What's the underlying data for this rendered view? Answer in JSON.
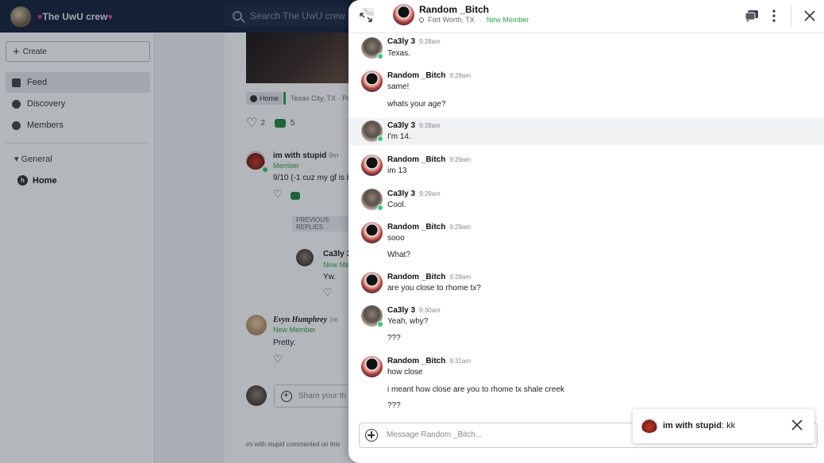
{
  "app": {
    "group_name": "The UwU crew",
    "search_placeholder": "Search The UwU crew"
  },
  "sidebar": {
    "create_label": "Create",
    "items": [
      {
        "label": "Feed",
        "icon": "feed-icon",
        "active": true
      },
      {
        "label": "Discovery",
        "icon": "compass-icon",
        "active": false
      },
      {
        "label": "Members",
        "icon": "members-icon",
        "active": false
      }
    ],
    "section_label": "General",
    "home_label": "Home"
  },
  "feed": {
    "chip_label": "Home",
    "location": "Texas City, TX · Po",
    "like_count": "2",
    "comment_count": "5",
    "comments": [
      {
        "name": "im with stupid",
        "time": "9m",
        "role": "Member",
        "text": "9/10 (-1 cuz my gf is b"
      },
      {
        "name": "Ca3ly 3",
        "time": "",
        "role": "New Mem",
        "text": "Yw."
      },
      {
        "name": "Evyn Humphrey",
        "time": "1m",
        "role": "New Member",
        "text": "Pretty."
      }
    ],
    "previous_replies_label": "PREVIOUS REPLIES",
    "reply_placeholder": "Share your th",
    "activity_text": "im with stupid commented on this"
  },
  "chat": {
    "header": {
      "name": "Random _Bitch",
      "location": "Fort Worth, TX",
      "role": "New Member"
    },
    "messages": [
      {
        "author": "Ca3ly 3",
        "time": "9:28am",
        "lines": [
          "Texas."
        ],
        "online": true,
        "highlight": false
      },
      {
        "author": "Random _Bitch",
        "time": "9:28am",
        "lines": [
          "same!",
          "whats your age?"
        ],
        "online": false,
        "highlight": false
      },
      {
        "author": "Ca3ly 3",
        "time": "9:28am",
        "lines": [
          "I'm 14."
        ],
        "online": true,
        "highlight": true
      },
      {
        "author": "Random _Bitch",
        "time": "9:29am",
        "lines": [
          "im 13"
        ],
        "online": false,
        "highlight": false
      },
      {
        "author": "Ca3ly 3",
        "time": "9:29am",
        "lines": [
          "Cool."
        ],
        "online": true,
        "highlight": false
      },
      {
        "author": "Random _Bitch",
        "time": "9:29am",
        "lines": [
          "sooo",
          "What?"
        ],
        "online": false,
        "highlight": false
      },
      {
        "author": "Random _Bitch",
        "time": "9:29am",
        "lines": [
          "are you close to rhome tx?"
        ],
        "online": false,
        "highlight": false
      },
      {
        "author": "Ca3ly 3",
        "time": "9:30am",
        "lines": [
          "Yeah, why?",
          "???"
        ],
        "online": true,
        "highlight": false
      },
      {
        "author": "Random _Bitch",
        "time": "9:31am",
        "lines": [
          "how close",
          "i meant how close are you to rhome tx shale creek",
          "???"
        ],
        "online": false,
        "highlight": false
      }
    ],
    "composer_placeholder": "Message Random _Bitch..."
  },
  "toast": {
    "author": "im with stupid",
    "text": "kk"
  },
  "colors": {
    "topbar": "#16233a",
    "accent_green": "#2aa84a",
    "heart_pink": "#e0468a"
  }
}
